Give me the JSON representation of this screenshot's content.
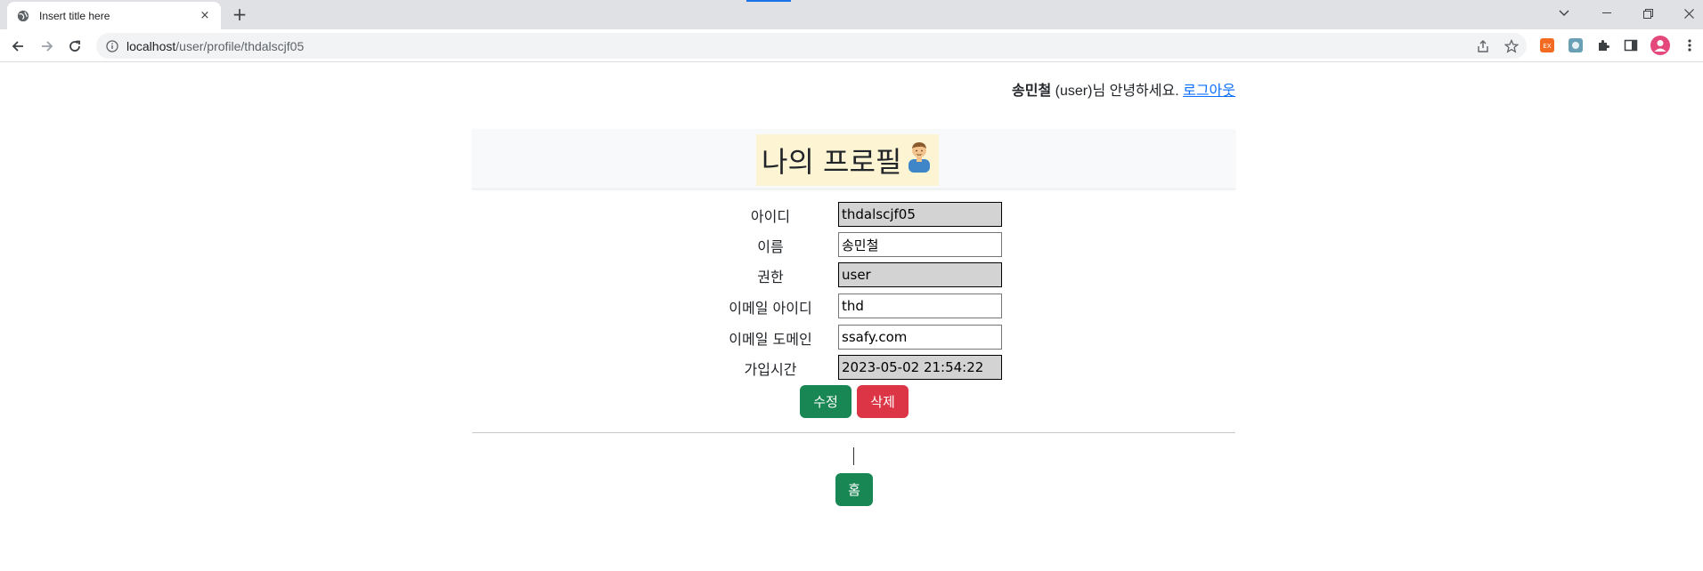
{
  "browser": {
    "tab_title": "Insert title here",
    "tab_close": "×",
    "new_tab": "+",
    "url_host": "localhost",
    "url_path": "/user/profile/thdalscjf05",
    "icons": [
      "globe-icon",
      "back-arrow-icon",
      "forward-arrow-icon",
      "reload-icon",
      "info-icon",
      "share-icon",
      "star-icon",
      "extension-icon",
      "puzzle-icon",
      "sidepanel-icon",
      "profile-avatar-icon",
      "menu-dots-icon"
    ]
  },
  "header": {
    "user_name": "송민철",
    "user_role": "(user)님 안녕하세요.",
    "logout_link": "로그아웃"
  },
  "page": {
    "title": "나의 프로필",
    "title_emoji": "🙍‍♂️"
  },
  "form": {
    "fields": [
      {
        "label": "아이디",
        "value": "thdalscjf05",
        "readonly": true
      },
      {
        "label": "이름",
        "value": "송민철",
        "readonly": false
      },
      {
        "label": "권한",
        "value": "user",
        "readonly": true
      },
      {
        "label": "이메일 아이디",
        "value": "thd",
        "readonly": false
      },
      {
        "label": "이메일 도메인",
        "value": "ssafy.com",
        "readonly": false
      },
      {
        "label": "가입시간",
        "value": "2023-05-02 21:54:22",
        "readonly": true
      }
    ],
    "edit_button": "수정",
    "delete_button": "삭제"
  },
  "footer": {
    "home_button": "홈"
  },
  "colors": {
    "success": "#198754",
    "danger": "#dc3545",
    "link": "#0d6efd",
    "title_highlight": "#fcf4d2"
  }
}
